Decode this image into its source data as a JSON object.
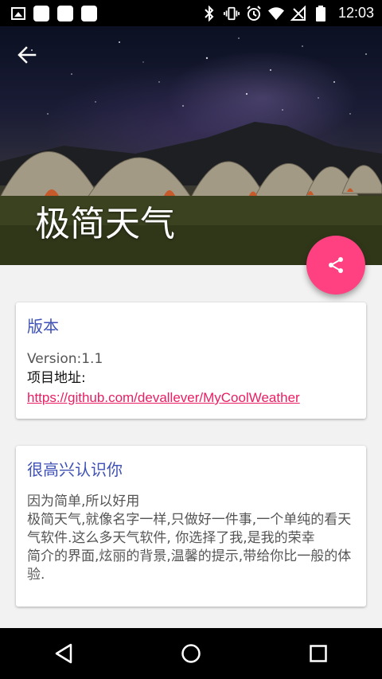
{
  "status_bar": {
    "time": "12:03",
    "icons": [
      "image-icon",
      "square-icon",
      "square-icon",
      "square-icon",
      "bluetooth-icon",
      "vibrate-icon",
      "alarm-icon",
      "wifi-icon",
      "no-signal-icon",
      "battery-icon"
    ]
  },
  "header": {
    "title": "极简天气"
  },
  "fab": {
    "icon": "share-icon",
    "color": "#ff4081"
  },
  "version_card": {
    "title": "版本",
    "version": "Version:1.1",
    "project_label": "项目地址:",
    "project_url": "https://github.com/devallever/MyCoolWeather"
  },
  "intro_card": {
    "title": "很高兴认识你",
    "body": "因为简单,所以好用\n极简天气,就像名字一样,只做好一件事,一个单纯的看天气软件.这么多天气软件, 你选择了我,是我的荣幸\n简介的界面,炫丽的背景,温馨的提示,带给你比一般的体验."
  },
  "colors": {
    "accent": "#ff4081",
    "primary": "#3f51b5",
    "link": "#e91e63"
  }
}
